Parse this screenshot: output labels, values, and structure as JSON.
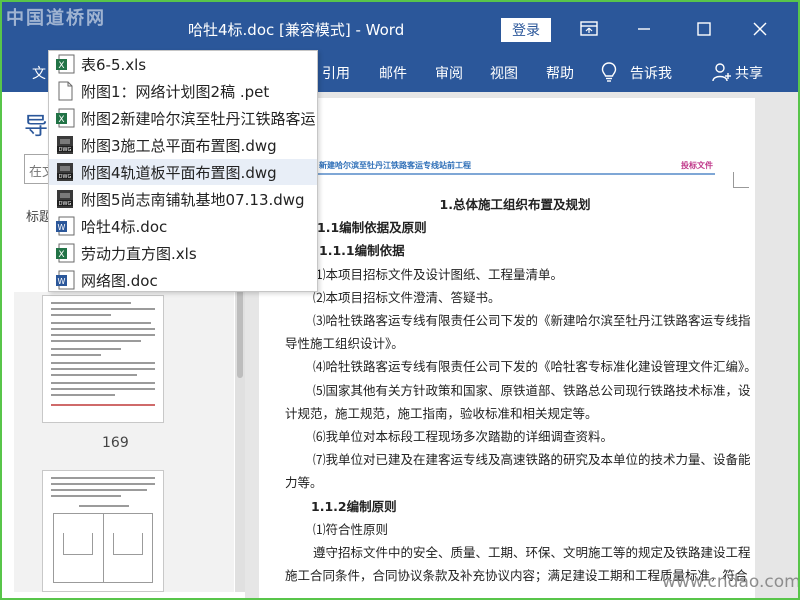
{
  "watermark": {
    "logo": "中国道桥网",
    "site": "www.cndao.com"
  },
  "titlebar": {
    "title": "哈牡4标.doc [兼容模式] - Word",
    "login_label": "登录",
    "icons": [
      "ribbon-display-icon",
      "minimize-icon",
      "maximize-icon",
      "close-icon"
    ]
  },
  "ribbon": {
    "first_tab": "文",
    "tabs": [
      "引用",
      "邮件",
      "审阅",
      "视图",
      "帮助"
    ],
    "tell_me": "告诉我",
    "share": "共享"
  },
  "recent_files": [
    {
      "name": "表6-5.xls",
      "type": "xls"
    },
    {
      "name": "附图1：网络计划图2稿 .pet",
      "type": "pet"
    },
    {
      "name": "附图2新建哈尔滨至牡丹江铁路客运",
      "type": "xls"
    },
    {
      "name": "附图3施工总平面布置图.dwg",
      "type": "dwg"
    },
    {
      "name": "附图4轨道板平面布置图.dwg",
      "type": "dwg"
    },
    {
      "name": "附图5尚志南铺轨基地07.13.dwg",
      "type": "dwg"
    },
    {
      "name": "哈牡4标.doc",
      "type": "doc"
    },
    {
      "name": "劳动力直方图.xls",
      "type": "xls"
    },
    {
      "name": "网络图.doc",
      "type": "doc"
    }
  ],
  "nav": {
    "title": "导",
    "search_placeholder": "在文",
    "headings_label": "标题",
    "page_number": "169"
  },
  "document": {
    "header_left": "新建哈尔滨至牡丹江铁路客运专线站前工程",
    "header_right": "投标文件",
    "lines": [
      "1.总体施工组织布置及规划",
      "1.1编制依据及原则",
      "1.1.1编制依据",
      "⑴本项目招标文件及设计图纸、工程量清单。",
      "⑵本项目招标文件澄清、答疑书。",
      "⑶哈牡铁路客运专线有限责任公司下发的《新建哈尔滨至牡丹江铁路客运专线指",
      "导性施工组织设计》。",
      "⑷哈牡铁路客运专线有限责任公司下发的《哈牡客专标准化建设管理文件汇编》。",
      "⑸国家其他有关方针政策和国家、原铁道部、铁路总公司现行铁路技术标准，设",
      "计规范，施工规范，施工指南，验收标准和相关规定等。",
      "⑹我单位对本标段工程现场多次踏勘的详细调查资料。",
      "⑺我单位对已建及在建客运专线及高速铁路的研究及本单位的技术力量、设备能",
      "力等。",
      "1.1.2编制原则",
      "⑴符合性原则",
      "遵守招标文件中的安全、质量、工期、环保、文明施工等的规定及铁路建设工程",
      "施工合同条件，合同协议条款及补充协议内容；满足建设工期和工程质量标准，符合"
    ]
  }
}
